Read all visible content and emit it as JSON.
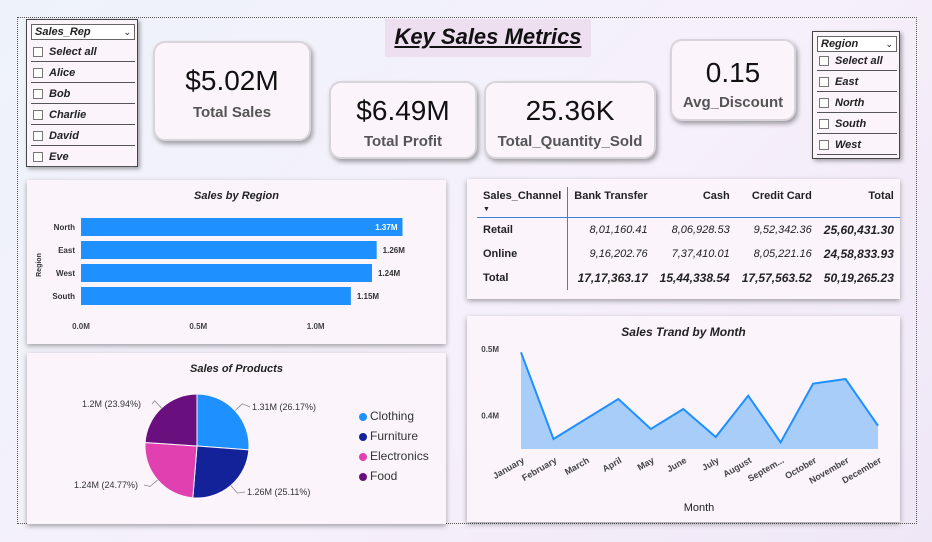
{
  "title": "Key Sales Metrics",
  "kpis": {
    "total_sales": {
      "value": "$5.02M",
      "label": "Total Sales"
    },
    "total_profit": {
      "value": "$6.49M",
      "label": "Total Profit"
    },
    "total_quantity": {
      "value": "25.36K",
      "label": "Total_Quantity_Sold"
    },
    "avg_discount": {
      "value": "0.15",
      "label": "Avg_Discount"
    }
  },
  "sales_rep_slicer": {
    "header": "Sales_Rep",
    "items": [
      "Select all",
      "Alice",
      "Bob",
      "Charlie",
      "David",
      "Eve"
    ]
  },
  "region_slicer": {
    "header": "Region",
    "items": [
      "Select all",
      "East",
      "North",
      "South",
      "West"
    ]
  },
  "matrix": {
    "headers": [
      "Sales_Channel",
      "Bank Transfer",
      "Cash",
      "Credit Card",
      "Total"
    ],
    "rows": [
      [
        "Retail",
        "8,01,160.41",
        "8,06,928.53",
        "9,52,342.36",
        "25,60,431.30"
      ],
      [
        "Online",
        "9,16,202.76",
        "7,37,410.01",
        "8,05,221.16",
        "24,58,833.93"
      ],
      [
        "Total",
        "17,17,363.17",
        "15,44,338.54",
        "17,57,563.52",
        "50,19,265.23"
      ]
    ]
  },
  "icons": {
    "sort": "sort-down-icon",
    "dropdown": "chevron-down-icon"
  },
  "chart_data": [
    {
      "type": "bar",
      "orientation": "horizontal",
      "title": "Sales by Region",
      "ylabel": "Region",
      "xlabel": "",
      "categories": [
        "North",
        "East",
        "West",
        "South"
      ],
      "values": [
        1.37,
        1.26,
        1.24,
        1.15
      ],
      "data_labels": [
        "1.37M",
        "1.26M",
        "1.24M",
        "1.15M"
      ],
      "xticks": [
        "0.0M",
        "0.5M",
        "1.0M"
      ],
      "xlim": [
        0,
        1.5
      ],
      "color": "#1e90ff",
      "grid": false
    },
    {
      "type": "pie",
      "title": "Sales of Products",
      "categories": [
        "Clothing",
        "Furniture",
        "Electronics",
        "Food"
      ],
      "values": [
        26.17,
        25.11,
        24.77,
        23.94
      ],
      "data_labels": [
        "1.31M (26.17%)",
        "1.26M (25.11%)",
        "1.24M (24.77%)",
        "1.2M (23.94%)"
      ],
      "colors": [
        "#1e90ff",
        "#14229a",
        "#e040b0",
        "#6a0f7e"
      ],
      "legend": "right"
    },
    {
      "type": "area",
      "title": "Sales Trand by Month",
      "xlabel": "Month",
      "ylabel": "",
      "x": [
        "January",
        "February",
        "March",
        "April",
        "May",
        "June",
        "July",
        "August",
        "Septem...",
        "October",
        "November",
        "December"
      ],
      "values": [
        0.495,
        0.365,
        0.395,
        0.425,
        0.38,
        0.41,
        0.368,
        0.43,
        0.36,
        0.448,
        0.455,
        0.385
      ],
      "yticks": [
        "0.5M",
        "0.4M"
      ],
      "ylim": [
        0.35,
        0.5
      ],
      "color": "#1e90ff",
      "fill": "#9ec9f7",
      "grid": false
    }
  ]
}
